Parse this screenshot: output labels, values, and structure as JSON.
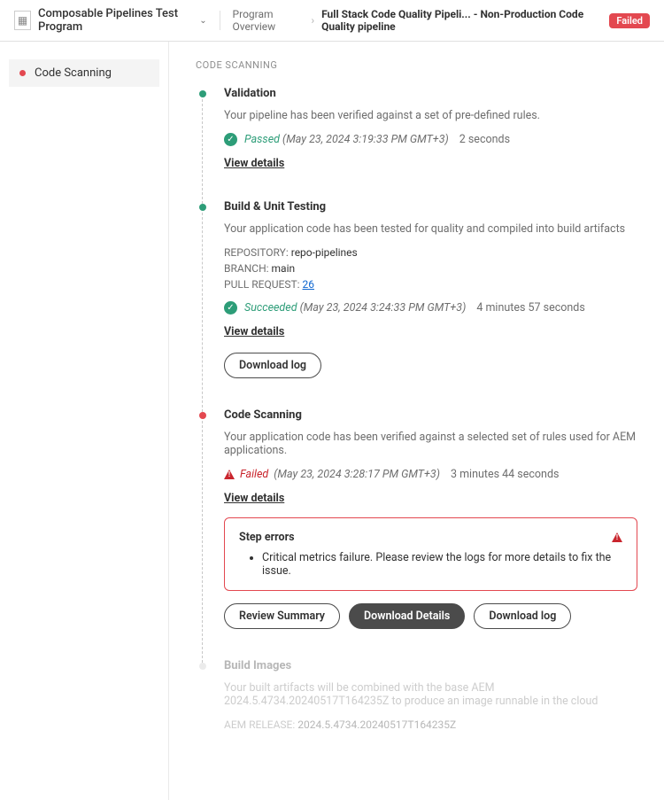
{
  "header": {
    "program": "Composable Pipelines Test Program",
    "crumb1": "Program Overview",
    "crumb2": "Full Stack Code Quality Pipeli... - Non-Production Code Quality pipeline",
    "status_badge": "Failed"
  },
  "sidebar": {
    "items": [
      {
        "label": "Code Scanning",
        "status": "red"
      }
    ]
  },
  "section_label": "CODE SCANNING",
  "steps": {
    "validation": {
      "title": "Validation",
      "desc": "Your pipeline has been verified against a set of pre-defined rules.",
      "status_text": "Passed",
      "timestamp": "(May 23, 2024 3:19:33 PM GMT+3)",
      "duration": "2 seconds",
      "view_details": "View details"
    },
    "build": {
      "title": "Build & Unit Testing",
      "desc": "Your application code has been tested for quality and compiled into build artifacts",
      "repo_key": "REPOSITORY:",
      "repo_val": "repo-pipelines",
      "branch_key": "BRANCH:",
      "branch_val": "main",
      "pr_key": "PULL REQUEST:",
      "pr_val": "26",
      "status_text": "Succeeded",
      "timestamp": "(May 23, 2024 3:24:33 PM GMT+3)",
      "duration": "4 minutes 57 seconds",
      "view_details": "View details",
      "download_log": "Download log"
    },
    "scan": {
      "title": "Code Scanning",
      "desc": "Your application code has been verified against a selected set of rules used for AEM applications.",
      "status_text": "Failed",
      "timestamp": "(May 23, 2024 3:28:17 PM GMT+3)",
      "duration": "3 minutes 44 seconds",
      "view_details": "View details",
      "error_header": "Step errors",
      "error_item": "Critical metrics failure. Please review the logs for more details to fix the issue.",
      "review_btn": "Review Summary",
      "download_details_btn": "Download Details",
      "download_log_btn": "Download log"
    },
    "images": {
      "title": "Build Images",
      "desc": "Your built artifacts will be combined with the base AEM 2024.5.4734.20240517T164235Z to produce an image runnable in the cloud",
      "release_key": "AEM RELEASE:",
      "release_val": "2024.5.4734.20240517T164235Z"
    }
  }
}
